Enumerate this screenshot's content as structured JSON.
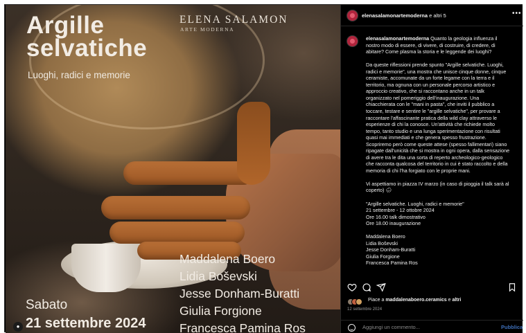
{
  "poster": {
    "title_line1": "Argille",
    "title_line2": "selvatiche",
    "subtitle": "Luoghi, radici e memorie",
    "brand": "ELENA SALAMON",
    "brand_sub": "ARTE MODERNA",
    "names": [
      "Maddalena Boero",
      "Lidia Boševski",
      "Jesse Donham-Buratti",
      "Giulia Forgione",
      "Francesca Pamina Ros"
    ],
    "day": "Sabato",
    "date": "21 settembre 2024"
  },
  "header": {
    "username": "elenasalamonartemoderna",
    "others": "e altri 5",
    "more_icon": "more-horizontal-icon"
  },
  "caption": {
    "username": "elenasalamonartemoderna",
    "intro_lines": [
      "Quanto la geologia influenza il",
      "nostro modo di essere, di vivere, di costruire, di credere, di",
      "abitare? Come plasma la storia e le leggende dei luoghi?"
    ],
    "paragraph2": [
      "Da queste riflessioni prende spunto \"Argille selvatiche. Luoghi,",
      "radici e memorie\", una mostra che unisce cinque donne, cinque",
      "ceramiste, accomunate da un forte legame con la terra e il",
      "territorio, ma ognuna con un personale percorso artistico e",
      "approccio creativo, che si raccontano anche in un talk",
      "organizzato nel pomeriggio dell'inaugurazione. Una",
      "chiacchierata con le \"mani in pasta\", che inviti il pubblico a",
      "toccare, testare e sentire le \"argille selvatiche\", per provare a",
      "raccontare l'affascinante pratica della wild clay attraverso le",
      "esperienze di chi la conosce. Un'attività che richiede molto",
      "tempo, tanto studio e una lunga sperimentazione con risultati",
      "quasi mai immediati e che genera spesso frustrazione.",
      "Scopriremo però come queste attese (spesso fallimentari) siano",
      "ripagate dall'unicità che si mostra in ogni opera, dalla sensazione",
      "di avere tra le dita una sorta di reperto archeologico-geologico",
      "che racconta qualcosa del territorio in cui è stato raccolto e della",
      "memoria di chi l'ha forgiato con le proprie mani."
    ],
    "paragraph3": [
      "Vi aspettiamo in piazza IV marzo (in caso di pioggia il talk sarà al",
      "coperto) 🌧"
    ],
    "paragraph4": [
      "\"Argille selvatiche. Luoghi, radici e memorie\"",
      "21 settembre - 12 ottobre 2024",
      "Ore 16.00 talk dimostrativo",
      "Ore 18.00 inaugurazione"
    ],
    "paragraph5": [
      "Maddalena Boero",
      "Lidia Boševski",
      "Jesse Donham-Buratti",
      "Giulia Forgione",
      "Francesca Pamina Ros"
    ]
  },
  "likes": {
    "prefix": "Piace a",
    "user": "maddalenaboero.ceramics",
    "conj": "e",
    "others": "altri"
  },
  "post_date": "12 settembre 2024",
  "comment": {
    "placeholder": "Aggiungi un commento...",
    "publish_label": "Pubblica"
  },
  "colors": {
    "background": "#000000",
    "accent_link": "#3e6fb8",
    "avatar": "#b0243c"
  }
}
